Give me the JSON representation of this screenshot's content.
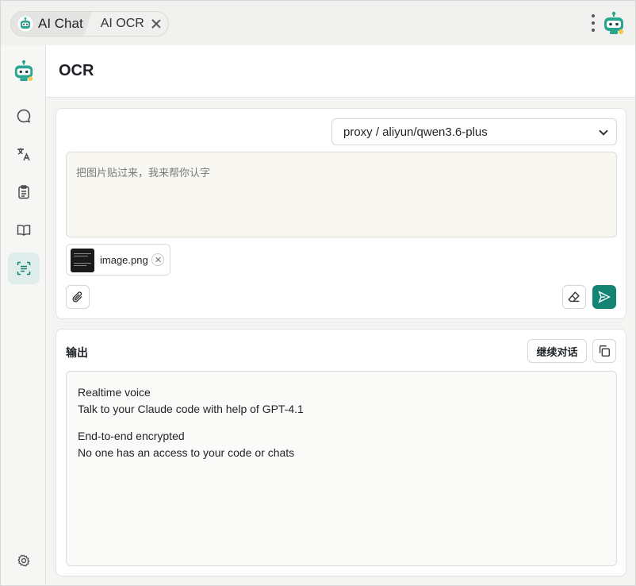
{
  "tabs": [
    {
      "label": "AI Chat",
      "active": true
    },
    {
      "label": "AI OCR",
      "active": false
    }
  ],
  "header": {
    "title": "OCR"
  },
  "sidebar": {
    "items": [
      {
        "icon": "chat-bubble-icon",
        "label": "Chat"
      },
      {
        "icon": "translate-icon",
        "label": "Translate"
      },
      {
        "icon": "clipboard-icon",
        "label": "Notes"
      },
      {
        "icon": "book-icon",
        "label": "Reader"
      },
      {
        "icon": "ocr-scan-icon",
        "label": "OCR",
        "active": true
      }
    ],
    "settings_icon": "gear-icon"
  },
  "input_card": {
    "model": "proxy / aliyun/qwen3.6-plus",
    "prompt_placeholder": "把图片贴过来，我来帮你认字",
    "attachment": {
      "name": "image.png"
    }
  },
  "output_card": {
    "label": "输出",
    "continue_label": "继续对话",
    "paragraphs": [
      [
        "Realtime voice",
        "Talk to your Claude code with help of GPT-4.1"
      ],
      [
        "End-to-end encrypted",
        "No one has an access to your code or chats"
      ]
    ]
  },
  "colors": {
    "accent": "#138373",
    "active_nav_bg": "#dfeeea",
    "prompt_bg": "#f8f7f1"
  }
}
